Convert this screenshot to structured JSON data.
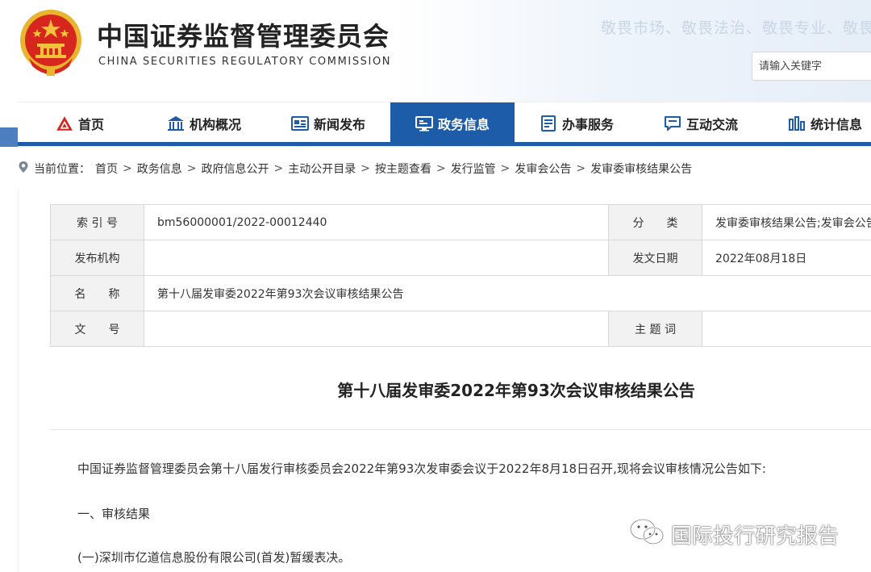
{
  "header": {
    "title_cn": "中国证券监督管理委员会",
    "title_en": "CHINA SECURITIES REGULATORY COMMISSION",
    "slogan": "敬畏市场、敬畏法治、敬畏专业、敬畏",
    "search_placeholder": "请输入关键字"
  },
  "nav": {
    "items": [
      {
        "label": "首页",
        "icon": "csrc-logo-icon"
      },
      {
        "label": "机构概况",
        "icon": "building-icon"
      },
      {
        "label": "新闻发布",
        "icon": "newspaper-icon"
      },
      {
        "label": "政务信息",
        "icon": "monitor-icon"
      },
      {
        "label": "办事服务",
        "icon": "document-list-icon"
      },
      {
        "label": "互动交流",
        "icon": "chat-icon"
      },
      {
        "label": "统计信息",
        "icon": "bar-chart-icon"
      }
    ],
    "active_index": 3
  },
  "breadcrumb": {
    "prefix": "当前位置：",
    "items": [
      "首页",
      "政务信息",
      "政府信息公开",
      "主动公开目录",
      "按主题查看",
      "发行监管",
      "发审会公告",
      "发审委审核结果公告"
    ]
  },
  "meta": {
    "index_label": "索 引 号",
    "index_value": "bm56000001/2022-00012440",
    "category_label": "分　　类",
    "category_value": "发审委审核结果公告;发审会公告",
    "issuer_label": "发布机构",
    "issuer_value": "",
    "date_label": "发文日期",
    "date_value": "2022年08月18日",
    "name_label": "名　　称",
    "name_value": "第十八届发审委2022年第93次会议审核结果公告",
    "docno_label": "文　　号",
    "docno_value": "",
    "keywords_label": "主 题 词",
    "keywords_value": ""
  },
  "article": {
    "title": "第十八届发审委2022年第93次会议审核结果公告",
    "p1": "中国证券监督管理委员会第十八届发行审核委员会2022年第93次发审委会议于2022年8月18日召开,现将会议审核情况公告如下:",
    "p2": "一、审核结果",
    "p3": "(一)深圳市亿道信息股份有限公司(首发)暂缓表决。"
  },
  "watermark": {
    "text": "国际投行研究报告"
  },
  "colors": {
    "primary": "#1d5ca8",
    "emblem_red": "#d7261e",
    "emblem_gold": "#f3c23a"
  }
}
